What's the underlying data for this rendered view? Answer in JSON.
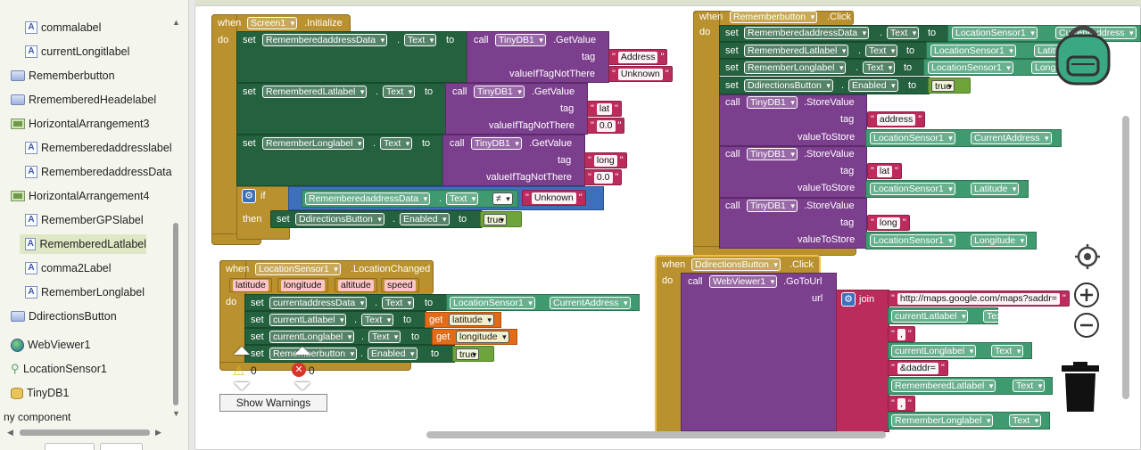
{
  "components": {
    "items": [
      {
        "label": "commalabel",
        "icon": "label-icon"
      },
      {
        "label": "currentLongitlabel",
        "icon": "label-icon"
      },
      {
        "label": "Rememberbutton",
        "icon": "button-icon"
      },
      {
        "label": "RrememberedHeadelabel",
        "icon": "button-icon"
      },
      {
        "label": "HorizontalArrangement3",
        "icon": "horizontal-arrangement-icon"
      },
      {
        "label": "Rememberedaddresslabel",
        "icon": "label-icon"
      },
      {
        "label": "RememberedaddressData",
        "icon": "label-icon"
      },
      {
        "label": "HorizontalArrangement4",
        "icon": "horizontal-arrangement-icon"
      },
      {
        "label": "RememberGPSlabel",
        "icon": "label-icon"
      },
      {
        "label": "RememberedLatlabel",
        "icon": "label-icon"
      },
      {
        "label": "comma2Label",
        "icon": "label-icon"
      },
      {
        "label": "RememberLonglabel",
        "icon": "label-icon"
      },
      {
        "label": "DdirectionsButton",
        "icon": "button-icon"
      },
      {
        "label": "WebViewer1",
        "icon": "webviewer-icon"
      },
      {
        "label": "LocationSensor1",
        "icon": "location-icon"
      },
      {
        "label": "TinyDB1",
        "icon": "database-icon"
      }
    ],
    "footer": "ny component"
  },
  "kw": {
    "when": "when",
    "do": "do",
    "set": "set",
    "to": "to",
    "call": "call",
    "tag": "tag",
    "valueIfTagNotThere": "valueIfTagNotThere",
    "valueToStore": "valueToStore",
    "if": "if",
    "then": "then",
    "url": "url",
    "join": "join",
    "get": "get",
    "dot": "."
  },
  "screen_init": {
    "event": "Screen1",
    "event_name": ".Initialize",
    "rows": [
      {
        "target": "RememberedaddressData",
        "prop": "Text",
        "db": "TinyDB1",
        "method": ".GetValue",
        "tag": "Address",
        "default": "Unknown"
      },
      {
        "target": "RememberedLatlabel",
        "prop": "Text",
        "db": "TinyDB1",
        "method": ".GetValue",
        "tag": "lat",
        "default": "0.0"
      },
      {
        "target": "RememberLonglabel",
        "prop": "Text",
        "db": "TinyDB1",
        "method": ".GetValue",
        "tag": "long",
        "default": "0.0"
      }
    ],
    "if_left": "RememberedaddressData",
    "if_prop": "Text",
    "if_op": "≠",
    "if_right": "Unknown",
    "then_target": "DdirectionsButton",
    "then_prop": "Enabled",
    "then_value": "true"
  },
  "remember_click": {
    "event": "Rememberbutton",
    "event_name": ".Click",
    "sets": [
      {
        "target": "RememberedaddressData",
        "prop": "Text",
        "src": "LocationSensor1",
        "src_prop": "CurrentAddress"
      },
      {
        "target": "RememberedLatlabel",
        "prop": "Text",
        "src": "LocationSensor1",
        "src_prop": "Latitude"
      },
      {
        "target": "RememberLonglabel",
        "prop": "Text",
        "src": "LocationSensor1",
        "src_prop": "Longitude"
      },
      {
        "target": "DdirectionsButton",
        "prop": "Enabled",
        "value": "true"
      }
    ],
    "stores": [
      {
        "db": "TinyDB1",
        "method": ".StoreValue",
        "tag": "address",
        "src": "LocationSensor1",
        "src_prop": "CurrentAddress"
      },
      {
        "db": "TinyDB1",
        "method": ".StoreValue",
        "tag": "lat",
        "src": "LocationSensor1",
        "src_prop": "Latitude"
      },
      {
        "db": "TinyDB1",
        "method": ".StoreValue",
        "tag": "long",
        "src": "LocationSensor1",
        "src_prop": "Longitude"
      }
    ]
  },
  "location_changed": {
    "event": "LocationSensor1",
    "event_name": ".LocationChanged",
    "params": [
      "latitude",
      "longitude",
      "altitude",
      "speed"
    ],
    "rows": [
      {
        "target": "currentaddressData",
        "prop": "Text",
        "src": "LocationSensor1",
        "src_prop": "CurrentAddress"
      },
      {
        "target": "currentLatlabel",
        "prop": "Text",
        "get": "latitude"
      },
      {
        "target": "currentLonglabel",
        "prop": "Text",
        "get": "longitude"
      },
      {
        "target": "Rememberbutton",
        "prop": "Enabled",
        "value": "true"
      }
    ]
  },
  "directions_click": {
    "event": "DdirectionsButton",
    "event_name": ".Click",
    "call": "WebViewer1",
    "method": ".GoToUrl",
    "join": [
      {
        "type": "text",
        "value": "http://maps.google.com/maps?saddr="
      },
      {
        "type": "prop",
        "comp": "currentLatlabel",
        "prop": "Text"
      },
      {
        "type": "text",
        "value": ","
      },
      {
        "type": "prop",
        "comp": "currentLonglabel",
        "prop": "Text"
      },
      {
        "type": "text",
        "value": "&daddr="
      },
      {
        "type": "prop",
        "comp": "RememberedLatlabel",
        "prop": "Text"
      },
      {
        "type": "text",
        "value": ","
      },
      {
        "type": "prop",
        "comp": "RememberLonglabel",
        "prop": "Text"
      }
    ]
  },
  "warnings": {
    "warn_count": "0",
    "error_count": "0",
    "button": "Show Warnings"
  }
}
